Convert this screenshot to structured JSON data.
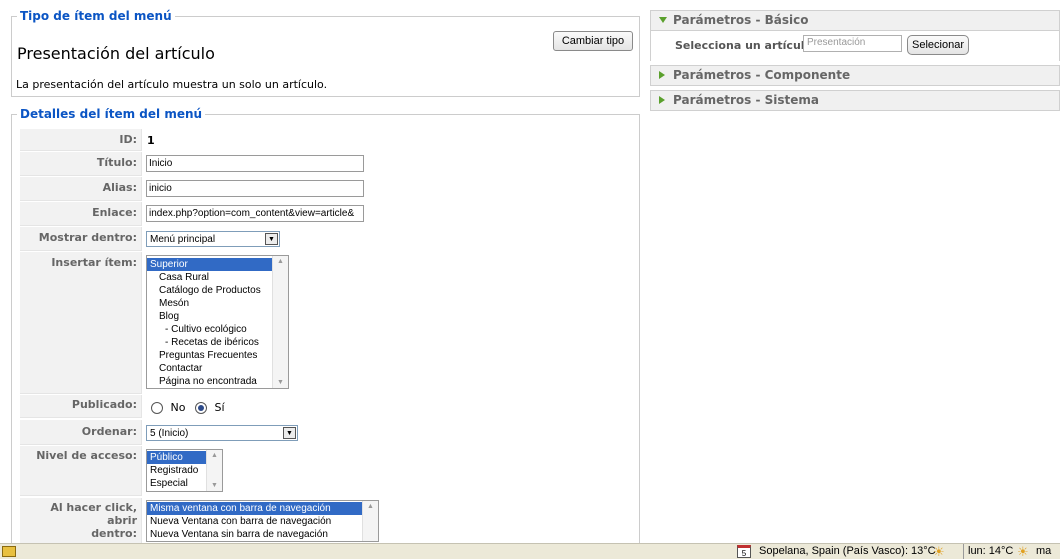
{
  "tipo": {
    "legend": "Tipo de ítem del menú",
    "title": "Presentación del artículo",
    "description": "La presentación del artículo muestra un solo un artículo.",
    "change_button": "Cambiar tipo"
  },
  "detalles": {
    "legend": "Detalles del ítem del menú",
    "id_label": "ID:",
    "id_value": "1",
    "titulo_label": "Título:",
    "titulo_value": "Inicio",
    "alias_label": "Alias:",
    "alias_value": "inicio",
    "enlace_label": "Enlace:",
    "enlace_value": "index.php?option=com_content&view=article&",
    "mostrar_label": "Mostrar dentro:",
    "mostrar_value": "Menú principal",
    "insertar_label": "Insertar ítem:",
    "insertar_options": [
      "Superior",
      "Casa Rural",
      "Catálogo de Productos",
      "Mesón",
      "Blog",
      "- Cultivo ecológico",
      "- Recetas de ibéricos",
      "Preguntas Frecuentes",
      "Contactar",
      "Página no encontrada"
    ],
    "publicado_label": "Publicado:",
    "publicado_no": "No",
    "publicado_si": "Sí",
    "ordenar_label": "Ordenar:",
    "ordenar_value": "5 (Inicio)",
    "nivel_label": "Nivel de acceso:",
    "nivel_options": [
      "Público",
      "Registrado",
      "Especial"
    ],
    "click_label_1": "Al hacer click, abrir",
    "click_label_2": "dentro:",
    "click_options": [
      "Misma ventana con barra de navegación",
      "Nueva Ventana con barra de navegación",
      "Nueva Ventana sin barra de navegación"
    ]
  },
  "params": {
    "basico_header": "Parámetros - Básico",
    "select_article_label": "Selecciona un artículo",
    "select_article_placeholder": "Presentación",
    "select_button": "Selecionar",
    "componente_header": "Parámetros - Componente",
    "sistema_header": "Parámetros - Sistema"
  },
  "taskbar": {
    "calendar_day": "5",
    "weather_1": "Sopelana, Spain (País Vasco): 13°C",
    "weather_2": "lun: 14°C",
    "weather_3": "ma"
  },
  "colors": {
    "legend_blue": "#0b55c4",
    "panel_green": "#5aa02c",
    "selection_blue": "#316ac5"
  }
}
